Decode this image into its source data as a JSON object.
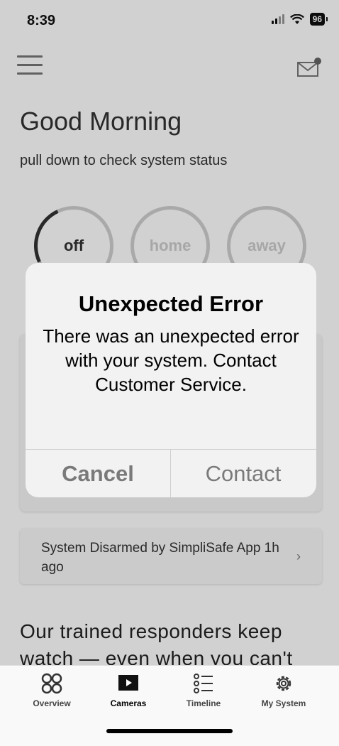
{
  "status_bar": {
    "time": "8:39",
    "battery": "96"
  },
  "header": {
    "greeting": "Good Morning",
    "subtitle": "pull down to check system status"
  },
  "modes": {
    "off": "off",
    "home": "home",
    "away": "away"
  },
  "event": {
    "text": "System Disarmed by SimpliSafe App 1h ago"
  },
  "promo": {
    "text": "Our trained responders keep watch — even when you can't"
  },
  "alert": {
    "title": "Unexpected Error",
    "message": "There was an unexpected error with your system. Contact Customer Service.",
    "cancel_label": "Cancel",
    "contact_label": "Contact"
  },
  "tabs": [
    {
      "label": "Overview",
      "icon": "overview-icon"
    },
    {
      "label": "Cameras",
      "icon": "camera-play-icon"
    },
    {
      "label": "Timeline",
      "icon": "timeline-list-icon"
    },
    {
      "label": "My System",
      "icon": "gear-icon"
    }
  ]
}
